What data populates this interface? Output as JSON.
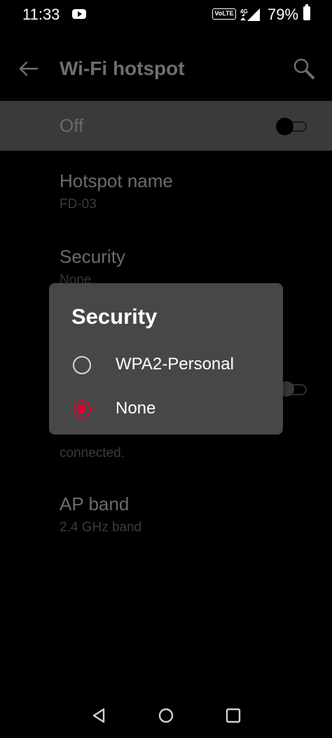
{
  "status_bar": {
    "time": "11:33",
    "volte": "VoLTE",
    "network": "4G",
    "battery": "79%"
  },
  "app_bar": {
    "title": "Wi-Fi hotspot",
    "back_icon": "back-arrow-icon",
    "search_icon": "search-icon"
  },
  "hotspot_toggle": {
    "label": "Off",
    "state": "off"
  },
  "settings": {
    "hotspot_name": {
      "title": "Hotspot name",
      "summary": "FD-03"
    },
    "security": {
      "title": "Security",
      "summary": "None"
    },
    "connected_note": "connected.",
    "ap_band": {
      "title": "AP band",
      "summary": "2.4 GHz band"
    }
  },
  "dialog": {
    "title": "Security",
    "options": [
      {
        "label": "WPA2-Personal",
        "selected": false
      },
      {
        "label": "None",
        "selected": true
      }
    ],
    "accent_color": "#e0002a"
  },
  "nav_bar": {
    "back": "back-triangle-icon",
    "home": "home-circle-icon",
    "recents": "recents-square-icon"
  }
}
